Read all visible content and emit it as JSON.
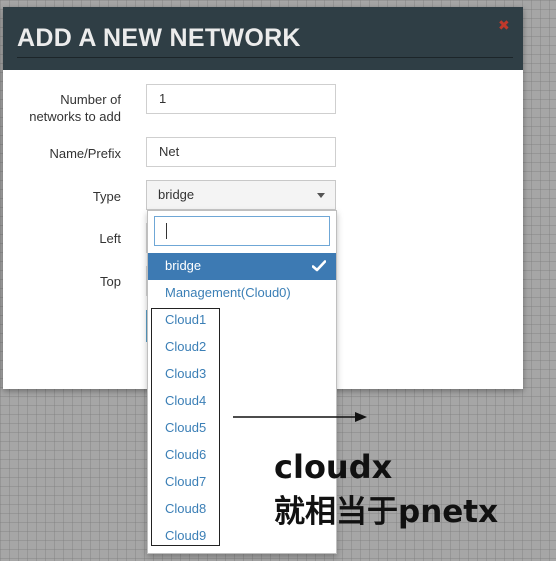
{
  "dialog": {
    "title": "ADD A NEW NETWORK",
    "close_glyph": "✖"
  },
  "form": {
    "number_label": "Number of networks to add",
    "number_value": "1",
    "name_label": "Name/Prefix",
    "name_value": "Net",
    "type_label": "Type",
    "type_value": "bridge",
    "left_label": "Left",
    "top_label": "Top"
  },
  "dropdown": {
    "search_value": "",
    "options": [
      {
        "label": "bridge",
        "selected": true
      },
      {
        "label": "Management(Cloud0)",
        "selected": false
      },
      {
        "label": "Cloud1",
        "selected": false
      },
      {
        "label": "Cloud2",
        "selected": false
      },
      {
        "label": "Cloud3",
        "selected": false
      },
      {
        "label": "Cloud4",
        "selected": false
      },
      {
        "label": "Cloud5",
        "selected": false
      },
      {
        "label": "Cloud6",
        "selected": false
      },
      {
        "label": "Cloud7",
        "selected": false
      },
      {
        "label": "Cloud8",
        "selected": false
      },
      {
        "label": "Cloud9",
        "selected": false
      }
    ]
  },
  "annotation": {
    "line1": "cloudx",
    "line2": "就相当于pnetx"
  },
  "colors": {
    "header_bg": "#2f3e45",
    "selected_option_bg": "#3d7ab3",
    "option_text": "#3b7fb6",
    "close_icon": "#c0392b"
  },
  "icons": {
    "close": "close-icon",
    "dropdown": "caret-down-icon",
    "selected": "checkmark-icon",
    "annotation_arrow": "arrow-right-icon"
  }
}
